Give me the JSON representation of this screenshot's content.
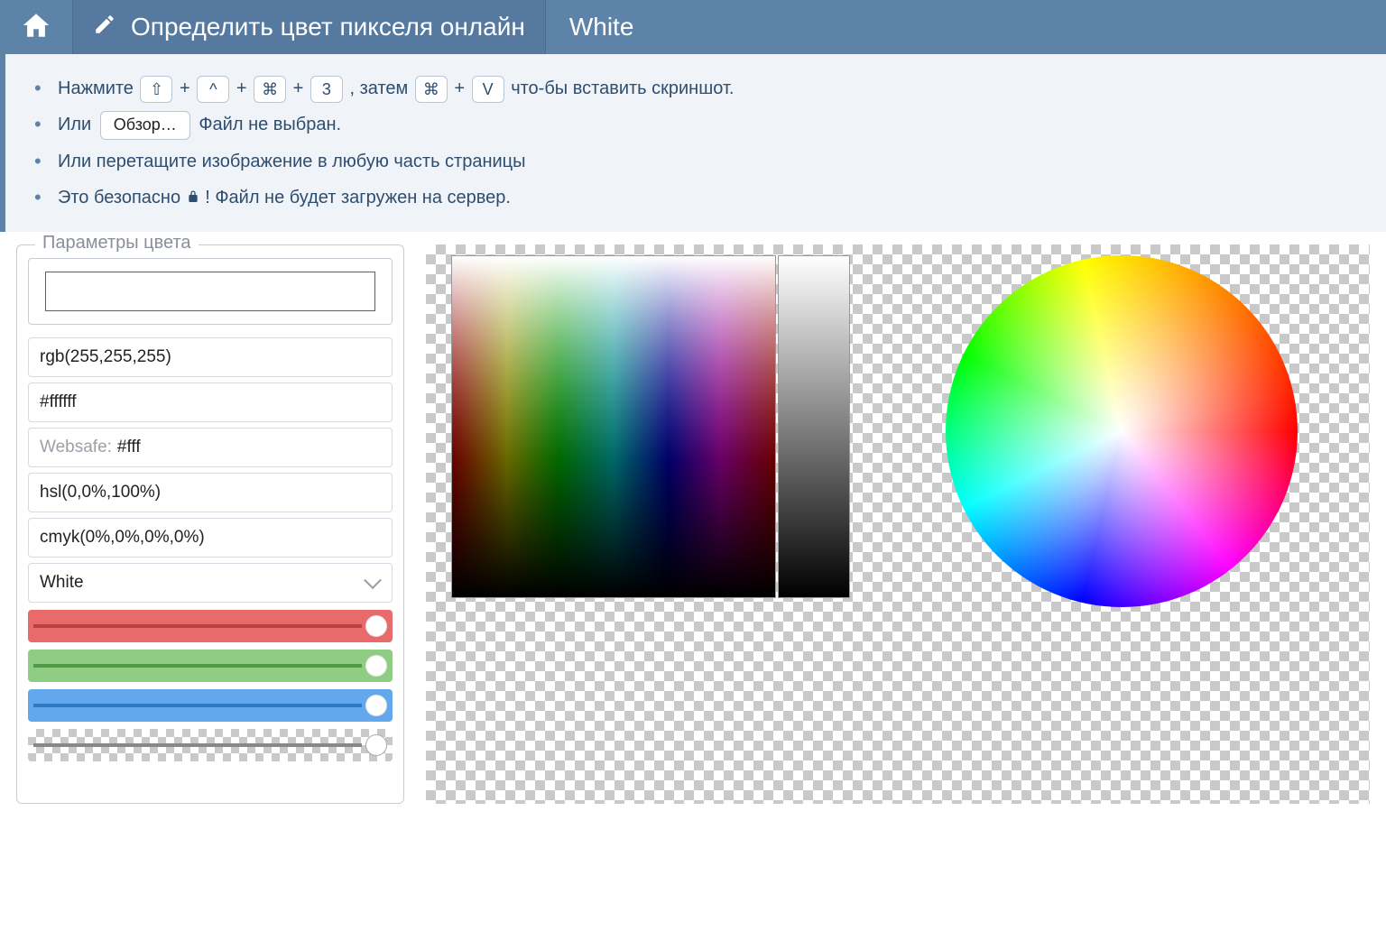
{
  "header": {
    "title": "Определить цвет пикселя онлайн",
    "color_name": "White"
  },
  "instructions": {
    "line1_pre": "Нажмите ",
    "key_shift": "⇧",
    "plus": " + ",
    "key_ctrl": "^",
    "key_cmd": "⌘",
    "key_3": "3",
    "line1_mid": ", затем ",
    "key_v": "V",
    "line1_post": " что-бы вставить скриншот.",
    "line2_pre": "Или ",
    "browse_label": "Обзор…",
    "line2_post": " Файл не выбран.",
    "line3": "Или перетащите изображение в любую часть страницы",
    "line4_pre": "Это безопасно ",
    "line4_post": "! Файл не будет загружен на сервер."
  },
  "params": {
    "legend": "Параметры цвета",
    "rgb": "rgb(255,255,255)",
    "hex": "#ffffff",
    "websafe_label": "Websafe:",
    "websafe_value": "#fff",
    "hsl": "hsl(0,0%,100%)",
    "cmyk": "cmyk(0%,0%,0%,0%)",
    "name": "White"
  },
  "sliders": {
    "r": 255,
    "g": 255,
    "b": 255,
    "a": 1
  }
}
